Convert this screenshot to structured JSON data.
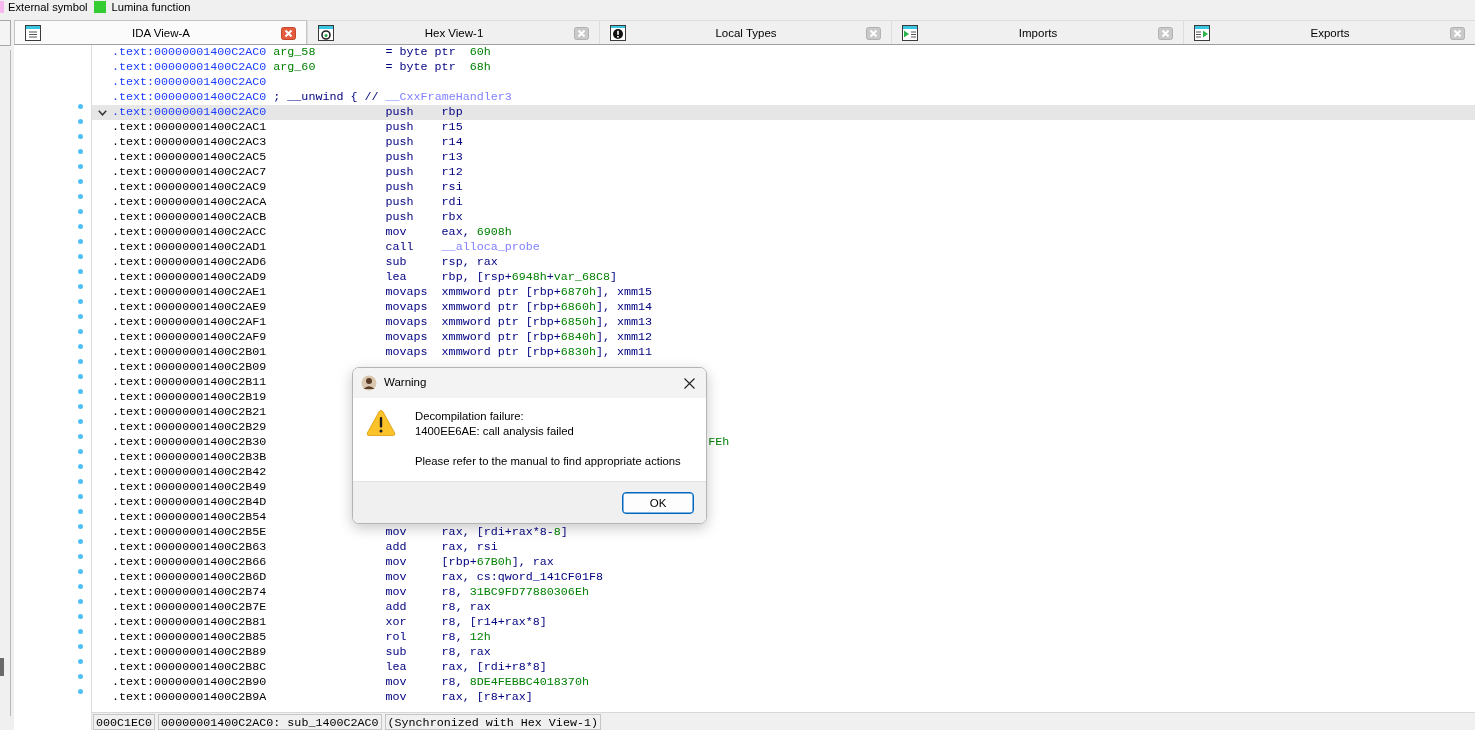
{
  "legend": [
    {
      "label": "External symbol",
      "color": "#f7b8f0"
    },
    {
      "label": "Lumina function",
      "color": "#33cc33"
    }
  ],
  "tabs": [
    {
      "label": "IDA View-A",
      "kind": "disassembly",
      "selected": true
    },
    {
      "label": "Hex View-1",
      "kind": "hex",
      "selected": false
    },
    {
      "label": "Local Types",
      "kind": "types",
      "selected": false
    },
    {
      "label": "Imports",
      "kind": "imports",
      "selected": false
    },
    {
      "label": "Exports",
      "kind": "exports",
      "selected": false
    }
  ],
  "listing": {
    "rows": [
      {
        "kind": "declaration",
        "selected": false,
        "address": ".text:00000001400C2AC0",
        "label": "arg_58",
        "operands": [
          {
            "text": "= byte ptr  ",
            "kind": "plain"
          },
          {
            "text": "60h",
            "kind": "number"
          }
        ]
      },
      {
        "kind": "declaration",
        "selected": false,
        "address": ".text:00000001400C2AC0",
        "label": "arg_60",
        "operands": [
          {
            "text": "= byte ptr  ",
            "kind": "plain"
          },
          {
            "text": "68h",
            "kind": "number"
          }
        ]
      },
      {
        "kind": "declaration",
        "selected": false,
        "address": ".text:00000001400C2AC0"
      },
      {
        "kind": "declaration",
        "selected": false,
        "address": ".text:00000001400C2AC0",
        "comment": [
          {
            "text": "; __unwind { // ",
            "kind": "plain"
          },
          {
            "text": "__CxxFrameHandler3",
            "kind": "symbol"
          }
        ]
      },
      {
        "kind": "function_start",
        "selected": true,
        "address": ".text:00000001400C2AC0",
        "mnemonic": "push",
        "operands": [
          {
            "text": "rbp",
            "kind": "plain"
          }
        ]
      },
      {
        "kind": "instruction",
        "selected": false,
        "address": ".text:00000001400C2AC1",
        "mnemonic": "push",
        "operands": [
          {
            "text": "r15",
            "kind": "plain"
          }
        ]
      },
      {
        "kind": "instruction",
        "selected": false,
        "address": ".text:00000001400C2AC3",
        "mnemonic": "push",
        "operands": [
          {
            "text": "r14",
            "kind": "plain"
          }
        ]
      },
      {
        "kind": "instruction",
        "selected": false,
        "address": ".text:00000001400C2AC5",
        "mnemonic": "push",
        "operands": [
          {
            "text": "r13",
            "kind": "plain"
          }
        ]
      },
      {
        "kind": "instruction",
        "selected": false,
        "address": ".text:00000001400C2AC7",
        "mnemonic": "push",
        "operands": [
          {
            "text": "r12",
            "kind": "plain"
          }
        ]
      },
      {
        "kind": "instruction",
        "selected": false,
        "address": ".text:00000001400C2AC9",
        "mnemonic": "push",
        "operands": [
          {
            "text": "rsi",
            "kind": "plain"
          }
        ]
      },
      {
        "kind": "instruction",
        "selected": false,
        "address": ".text:00000001400C2ACA",
        "mnemonic": "push",
        "operands": [
          {
            "text": "rdi",
            "kind": "plain"
          }
        ]
      },
      {
        "kind": "instruction",
        "selected": false,
        "address": ".text:00000001400C2ACB",
        "mnemonic": "push",
        "operands": [
          {
            "text": "rbx",
            "kind": "plain"
          }
        ]
      },
      {
        "kind": "instruction",
        "selected": false,
        "address": ".text:00000001400C2ACC",
        "mnemonic": "mov",
        "operands": [
          {
            "text": "eax, ",
            "kind": "plain"
          },
          {
            "text": "6908h",
            "kind": "number"
          }
        ]
      },
      {
        "kind": "instruction",
        "selected": false,
        "address": ".text:00000001400C2AD1",
        "mnemonic": "call",
        "operands": [
          {
            "text": "__alloca_probe",
            "kind": "symbol"
          }
        ]
      },
      {
        "kind": "instruction",
        "selected": false,
        "address": ".text:00000001400C2AD6",
        "mnemonic": "sub",
        "operands": [
          {
            "text": "rsp, rax",
            "kind": "plain"
          }
        ]
      },
      {
        "kind": "instruction",
        "selected": false,
        "address": ".text:00000001400C2AD9",
        "mnemonic": "lea",
        "operands": [
          {
            "text": "rbp, [rsp+",
            "kind": "plain"
          },
          {
            "text": "6948h",
            "kind": "number"
          },
          {
            "text": "+",
            "kind": "plain"
          },
          {
            "text": "var_68C8",
            "kind": "number"
          },
          {
            "text": "]",
            "kind": "plain"
          }
        ]
      },
      {
        "kind": "instruction",
        "selected": false,
        "address": ".text:00000001400C2AE1",
        "mnemonic": "movaps",
        "operands": [
          {
            "text": "xmmword ptr [rbp+",
            "kind": "plain"
          },
          {
            "text": "6870h",
            "kind": "number"
          },
          {
            "text": "], xmm15",
            "kind": "plain"
          }
        ]
      },
      {
        "kind": "instruction",
        "selected": false,
        "address": ".text:00000001400C2AE9",
        "mnemonic": "movaps",
        "operands": [
          {
            "text": "xmmword ptr [rbp+",
            "kind": "plain"
          },
          {
            "text": "6860h",
            "kind": "number"
          },
          {
            "text": "], xmm14",
            "kind": "plain"
          }
        ]
      },
      {
        "kind": "instruction",
        "selected": false,
        "address": ".text:00000001400C2AF1",
        "mnemonic": "movaps",
        "operands": [
          {
            "text": "xmmword ptr [rbp+",
            "kind": "plain"
          },
          {
            "text": "6850h",
            "kind": "number"
          },
          {
            "text": "], xmm13",
            "kind": "plain"
          }
        ]
      },
      {
        "kind": "instruction",
        "selected": false,
        "address": ".text:00000001400C2AF9",
        "mnemonic": "movaps",
        "operands": [
          {
            "text": "xmmword ptr [rbp+",
            "kind": "plain"
          },
          {
            "text": "6840h",
            "kind": "number"
          },
          {
            "text": "], xmm12",
            "kind": "plain"
          }
        ]
      },
      {
        "kind": "instruction",
        "selected": false,
        "address": ".text:00000001400C2B01",
        "mnemonic": "movaps",
        "operands": [
          {
            "text": "xmmword ptr [rbp+",
            "kind": "plain"
          },
          {
            "text": "6830h",
            "kind": "number"
          },
          {
            "text": "], xmm11",
            "kind": "plain"
          }
        ]
      },
      {
        "kind": "instruction",
        "selected": false,
        "address": ".text:00000001400C2B09"
      },
      {
        "kind": "instruction",
        "selected": false,
        "address": ".text:00000001400C2B11"
      },
      {
        "kind": "instruction",
        "selected": false,
        "address": ".text:00000001400C2B19"
      },
      {
        "kind": "instruction",
        "selected": false,
        "address": ".text:00000001400C2B21"
      },
      {
        "kind": "instruction",
        "selected": false,
        "address": ".text:00000001400C2B29"
      },
      {
        "kind": "instruction",
        "selected": false,
        "address": ".text:00000001400C2B30",
        "operand_tail": "FEh"
      },
      {
        "kind": "instruction",
        "selected": false,
        "address": ".text:00000001400C2B3B"
      },
      {
        "kind": "instruction",
        "selected": false,
        "address": ".text:00000001400C2B42"
      },
      {
        "kind": "instruction",
        "selected": false,
        "address": ".text:00000001400C2B49"
      },
      {
        "kind": "instruction",
        "selected": false,
        "address": ".text:00000001400C2B4D"
      },
      {
        "kind": "instruction",
        "selected": false,
        "address": ".text:00000001400C2B54"
      },
      {
        "kind": "instruction",
        "selected": false,
        "address": ".text:00000001400C2B5E",
        "mnemonic": "mov",
        "operands": [
          {
            "text": "rax, [rdi+rax*8-",
            "kind": "plain"
          },
          {
            "text": "8",
            "kind": "number"
          },
          {
            "text": "]",
            "kind": "plain"
          }
        ]
      },
      {
        "kind": "instruction",
        "selected": false,
        "address": ".text:00000001400C2B63",
        "mnemonic": "add",
        "operands": [
          {
            "text": "rax, rsi",
            "kind": "plain"
          }
        ]
      },
      {
        "kind": "instruction",
        "selected": false,
        "address": ".text:00000001400C2B66",
        "mnemonic": "mov",
        "operands": [
          {
            "text": "[rbp+",
            "kind": "plain"
          },
          {
            "text": "67B0h",
            "kind": "number"
          },
          {
            "text": "], rax",
            "kind": "plain"
          }
        ]
      },
      {
        "kind": "instruction",
        "selected": false,
        "address": ".text:00000001400C2B6D",
        "mnemonic": "mov",
        "operands": [
          {
            "text": "rax, cs:qword_141CF01F8",
            "kind": "plain"
          }
        ]
      },
      {
        "kind": "instruction",
        "selected": false,
        "address": ".text:00000001400C2B74",
        "mnemonic": "mov",
        "operands": [
          {
            "text": "r8, ",
            "kind": "plain"
          },
          {
            "text": "31BC9FD77880306Eh",
            "kind": "number"
          }
        ]
      },
      {
        "kind": "instruction",
        "selected": false,
        "address": ".text:00000001400C2B7E",
        "mnemonic": "add",
        "operands": [
          {
            "text": "r8, rax",
            "kind": "plain"
          }
        ]
      },
      {
        "kind": "instruction",
        "selected": false,
        "address": ".text:00000001400C2B81",
        "mnemonic": "xor",
        "operands": [
          {
            "text": "r8, [r14+rax*8]",
            "kind": "plain"
          }
        ]
      },
      {
        "kind": "instruction",
        "selected": false,
        "address": ".text:00000001400C2B85",
        "mnemonic": "rol",
        "operands": [
          {
            "text": "r8, ",
            "kind": "plain"
          },
          {
            "text": "12h",
            "kind": "number"
          }
        ]
      },
      {
        "kind": "instruction",
        "selected": false,
        "address": ".text:00000001400C2B89",
        "mnemonic": "sub",
        "operands": [
          {
            "text": "r8, rax",
            "kind": "plain"
          }
        ]
      },
      {
        "kind": "instruction",
        "selected": false,
        "address": ".text:00000001400C2B8C",
        "mnemonic": "lea",
        "operands": [
          {
            "text": "rax, [rdi+r8*8]",
            "kind": "plain"
          }
        ]
      },
      {
        "kind": "instruction",
        "selected": false,
        "address": ".text:00000001400C2B90",
        "mnemonic": "mov",
        "operands": [
          {
            "text": "r8, ",
            "kind": "plain"
          },
          {
            "text": "8DE4FEBBC4018370h",
            "kind": "number"
          }
        ]
      },
      {
        "kind": "instruction",
        "selected": false,
        "address": ".text:00000001400C2B9A",
        "mnemonic": "mov",
        "operands": [
          {
            "text": "rax, [r8+rax]",
            "kind": "plain"
          }
        ]
      }
    ]
  },
  "status_bar": [
    "000C1EC0",
    "00000001400C2AC0: sub_1400C2AC0",
    "(Synchronized with Hex View-1)"
  ],
  "dialog": {
    "title": "Warning",
    "paragraphs": [
      [
        "Decompilation failure:",
        "1400EE6AE: call analysis failed"
      ],
      [
        "Please refer to the manual to find appropriate actions"
      ]
    ],
    "buttons": [
      "OK"
    ]
  }
}
